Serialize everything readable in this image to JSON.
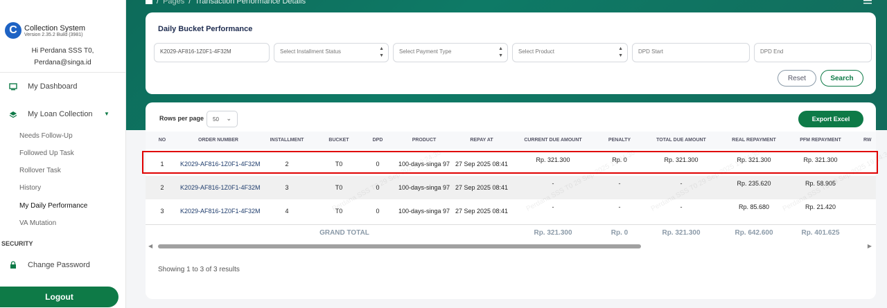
{
  "app": {
    "logo_letter": "C",
    "title": "Collection System",
    "version": "Version 2.35.2 Build (3981)",
    "user_name": "Hi Perdana SSS T0,",
    "user_email": "Perdana@singa.id"
  },
  "sidebar": {
    "dashboard": "My Dashboard",
    "loan_collection": "My Loan Collection",
    "sub_items": [
      "Needs Follow-Up",
      "Followed Up Task",
      "Rollover Task",
      "History",
      "My Daily Performance",
      "VA Mutation"
    ],
    "security_title": "SECURITY",
    "change_password": "Change Password",
    "logout": "Logout"
  },
  "breadcrumb": {
    "sep1": "/",
    "pages": "Pages",
    "sep2": "/",
    "current": "Transaction Performance Details"
  },
  "filter": {
    "title": "Daily Bucket Performance",
    "order_number": "K2029-AF816-1Z0F1-4F32M",
    "installment_status_placeholder": "Select Installment Status",
    "payment_type_placeholder": "Select Payment Type",
    "product_placeholder": "Select Product",
    "dpd_start_placeholder": "DPD Start",
    "dpd_end_placeholder": "DPD End",
    "reset_label": "Reset",
    "search_label": "Search"
  },
  "table": {
    "rows_per_page_label": "Rows per page",
    "rows_per_page_value": "50",
    "export_label": "Export Excel",
    "headers": [
      "NO",
      "ORDER NUMBER",
      "INSTALLMENT",
      "BUCKET",
      "DPD",
      "PRODUCT",
      "REPAY AT",
      "CURRENT DUE AMOUNT",
      "PENALTY",
      "TOTAL DUE AMOUNT",
      "REAL REPAYMENT",
      "PFM REPAYMENT",
      "RW"
    ],
    "rows": [
      {
        "no": "1",
        "order": "K2029-AF816-1Z0F1-4F32M",
        "installment": "2",
        "bucket": "T0",
        "dpd": "0",
        "product": "100-days-singa 97",
        "repay_at": "27 Sep 2025 08:41",
        "current_due": "Rp. 321.300",
        "penalty": "Rp. 0",
        "total_due": "Rp. 321.300",
        "real_repay": "Rp. 321.300",
        "pfm_repay": "Rp. 321.300"
      },
      {
        "no": "2",
        "order": "K2029-AF816-1Z0F1-4F32M",
        "installment": "3",
        "bucket": "T0",
        "dpd": "0",
        "product": "100-days-singa 97",
        "repay_at": "27 Sep 2025 08:41",
        "current_due": "-",
        "penalty": "-",
        "total_due": "-",
        "real_repay": "Rp. 235.620",
        "pfm_repay": "Rp. 58.905"
      },
      {
        "no": "3",
        "order": "K2029-AF816-1Z0F1-4F32M",
        "installment": "4",
        "bucket": "T0",
        "dpd": "0",
        "product": "100-days-singa 97",
        "repay_at": "27 Sep 2025 08:41",
        "current_due": "-",
        "penalty": "-",
        "total_due": "-",
        "real_repay": "Rp. 85.680",
        "pfm_repay": "Rp. 21.420"
      }
    ],
    "grand_total": {
      "label": "GRAND TOTAL",
      "current_due": "Rp. 321.300",
      "penalty": "Rp. 0",
      "total_due": "Rp. 321.300",
      "real_repay": "Rp. 642.600",
      "pfm_repay": "Rp. 401.625"
    },
    "result_text": "Showing 1 to 3 of 3 results",
    "watermark": "Perdana SSS T0 29 Sep 2025 19:24:30"
  }
}
